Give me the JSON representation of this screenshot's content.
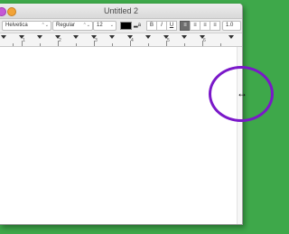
{
  "window": {
    "title": "Untitled 2"
  },
  "toolbar": {
    "font_family": "Helvetica",
    "font_style": "Regular",
    "font_size": "12",
    "bold_label": "B",
    "italic_label": "I",
    "underline_label": "U",
    "line_spacing": "1.0",
    "text_color": "#000000",
    "alignment_selected": "left"
  },
  "ruler": {
    "numbers": [
      "1",
      "2",
      "3",
      "4",
      "5",
      "6"
    ]
  },
  "annotation": {
    "highlight_color": "#7a18c9",
    "desktop_color": "#3ea84a"
  },
  "cursor": {
    "type": "resize-horizontal-cursor",
    "glyph": "↔"
  }
}
